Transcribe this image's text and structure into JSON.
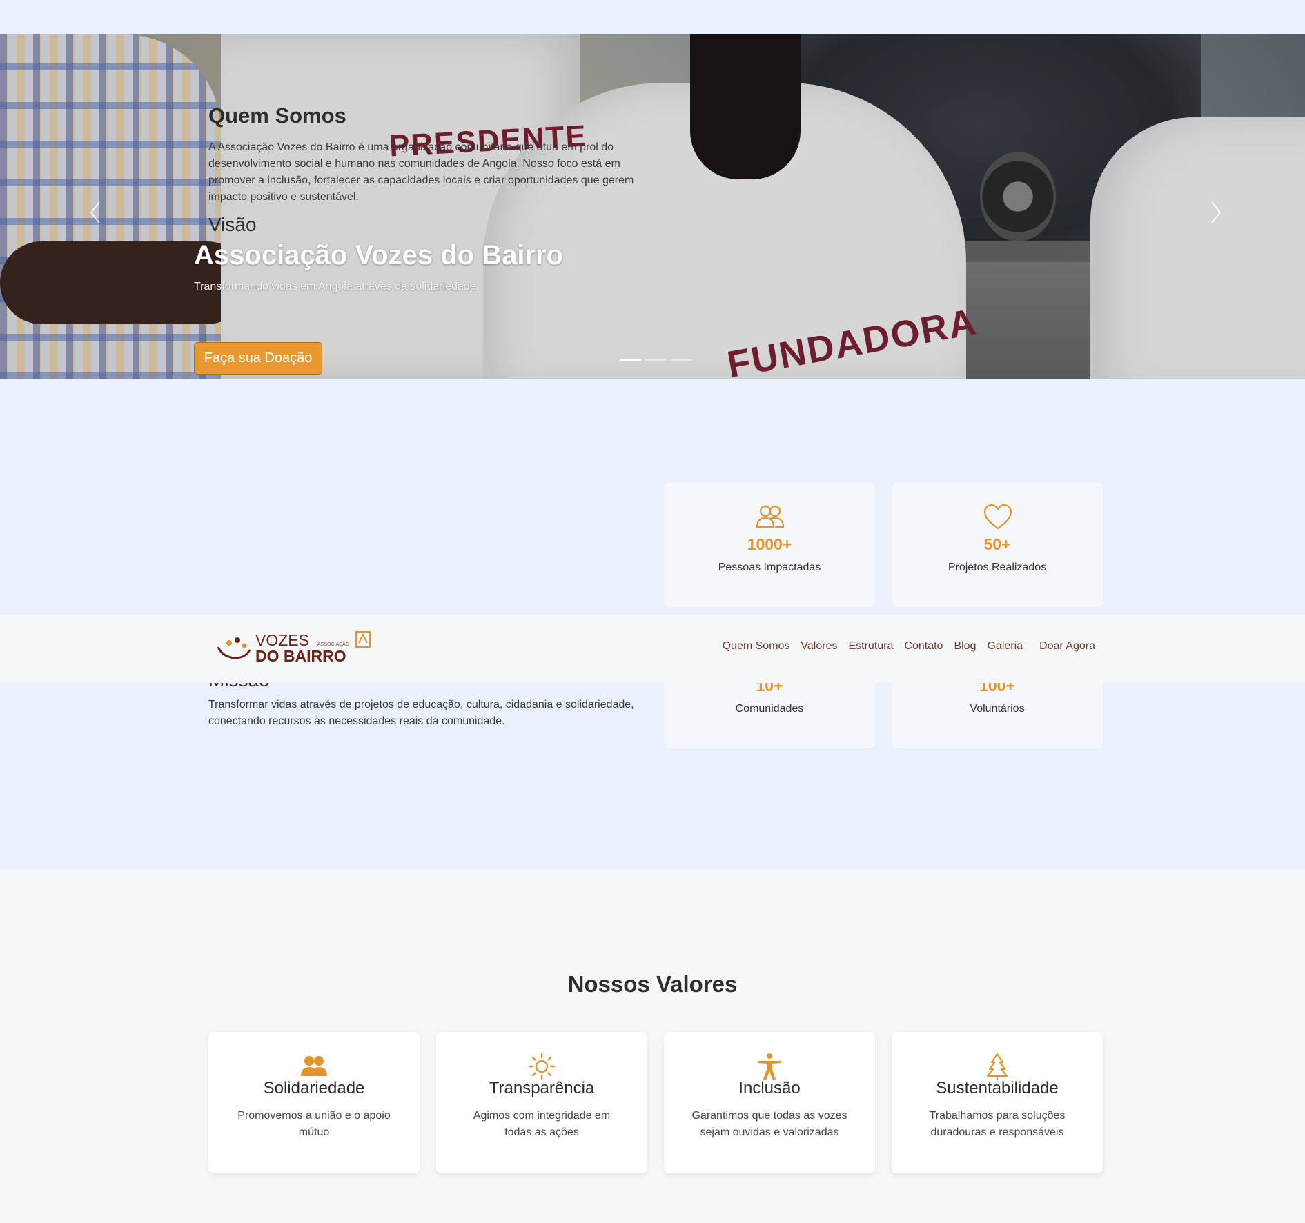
{
  "hero": {
    "title": "Associação Vozes do Bairro",
    "subtitle": "Transformando vidas em Angola através da solidariedade.",
    "cta_label": "Faça sua Doação",
    "shirt_text_1": "PRESDENTE",
    "shirt_text_2": "FUNDADORA",
    "prev_icon": "chevron-left-icon",
    "next_icon": "chevron-right-icon",
    "slides_count": 3,
    "active_slide": 1
  },
  "about": {
    "title": "Quem Somos",
    "description": "A Associação Vozes do Bairro é uma organização comunitária que atua em prol do desenvolvimento social e humano nas comunidades de Angola. Nosso foco está em promover a inclusão, fortalecer as capacidades locais e criar oportunidades que gerem impacto positivo e sustentável.",
    "vision_title": "Visão",
    "mission_title": "Missão",
    "mission_text": "Transformar vidas através de projetos de educação, cultura, cidadania e solidariedade, conectando recursos às necessidades reais da comunidade.",
    "stats": [
      {
        "icon": "people-icon",
        "value": "1000+",
        "label": "Pessoas Impactadas"
      },
      {
        "icon": "heart-icon",
        "value": "50+",
        "label": "Projetos Realizados"
      },
      {
        "icon": "community-icon",
        "value": "10+",
        "label": "Comunidades"
      },
      {
        "icon": "volunteer-icon",
        "value": "100+",
        "label": "Voluntários"
      }
    ]
  },
  "navbar": {
    "logo_text_top": "VOZES",
    "logo_text_small": "ASSOCIAÇÃO",
    "logo_text_bottom": "DO BAIRRO",
    "links": [
      {
        "label": "Quem Somos"
      },
      {
        "label": "Valores"
      },
      {
        "label": "Estrutura"
      },
      {
        "label": "Contato"
      },
      {
        "label": "Blog"
      },
      {
        "label": "Galeria"
      },
      {
        "label": "Doar Agora"
      }
    ]
  },
  "values": {
    "title": "Nossos Valores",
    "items": [
      {
        "icon": "people-fill-icon",
        "title": "Solidariedade",
        "description": "Promovemos a união e o apoio mútuo"
      },
      {
        "icon": "sun-icon",
        "title": "Transparência",
        "description": "Agimos com integridade em todas as ações"
      },
      {
        "icon": "universal-access-icon",
        "title": "Inclusão",
        "description": "Garantimos que todas as vozes sejam ouvidas e valorizadas"
      },
      {
        "icon": "tree-icon",
        "title": "Sustentabilidade",
        "description": "Trabalhamos para soluções duradouras e responsáveis"
      }
    ]
  },
  "colors": {
    "accent": "#e3942c",
    "background": "#eaf1fd",
    "brand_dark": "#6b3a2a"
  }
}
